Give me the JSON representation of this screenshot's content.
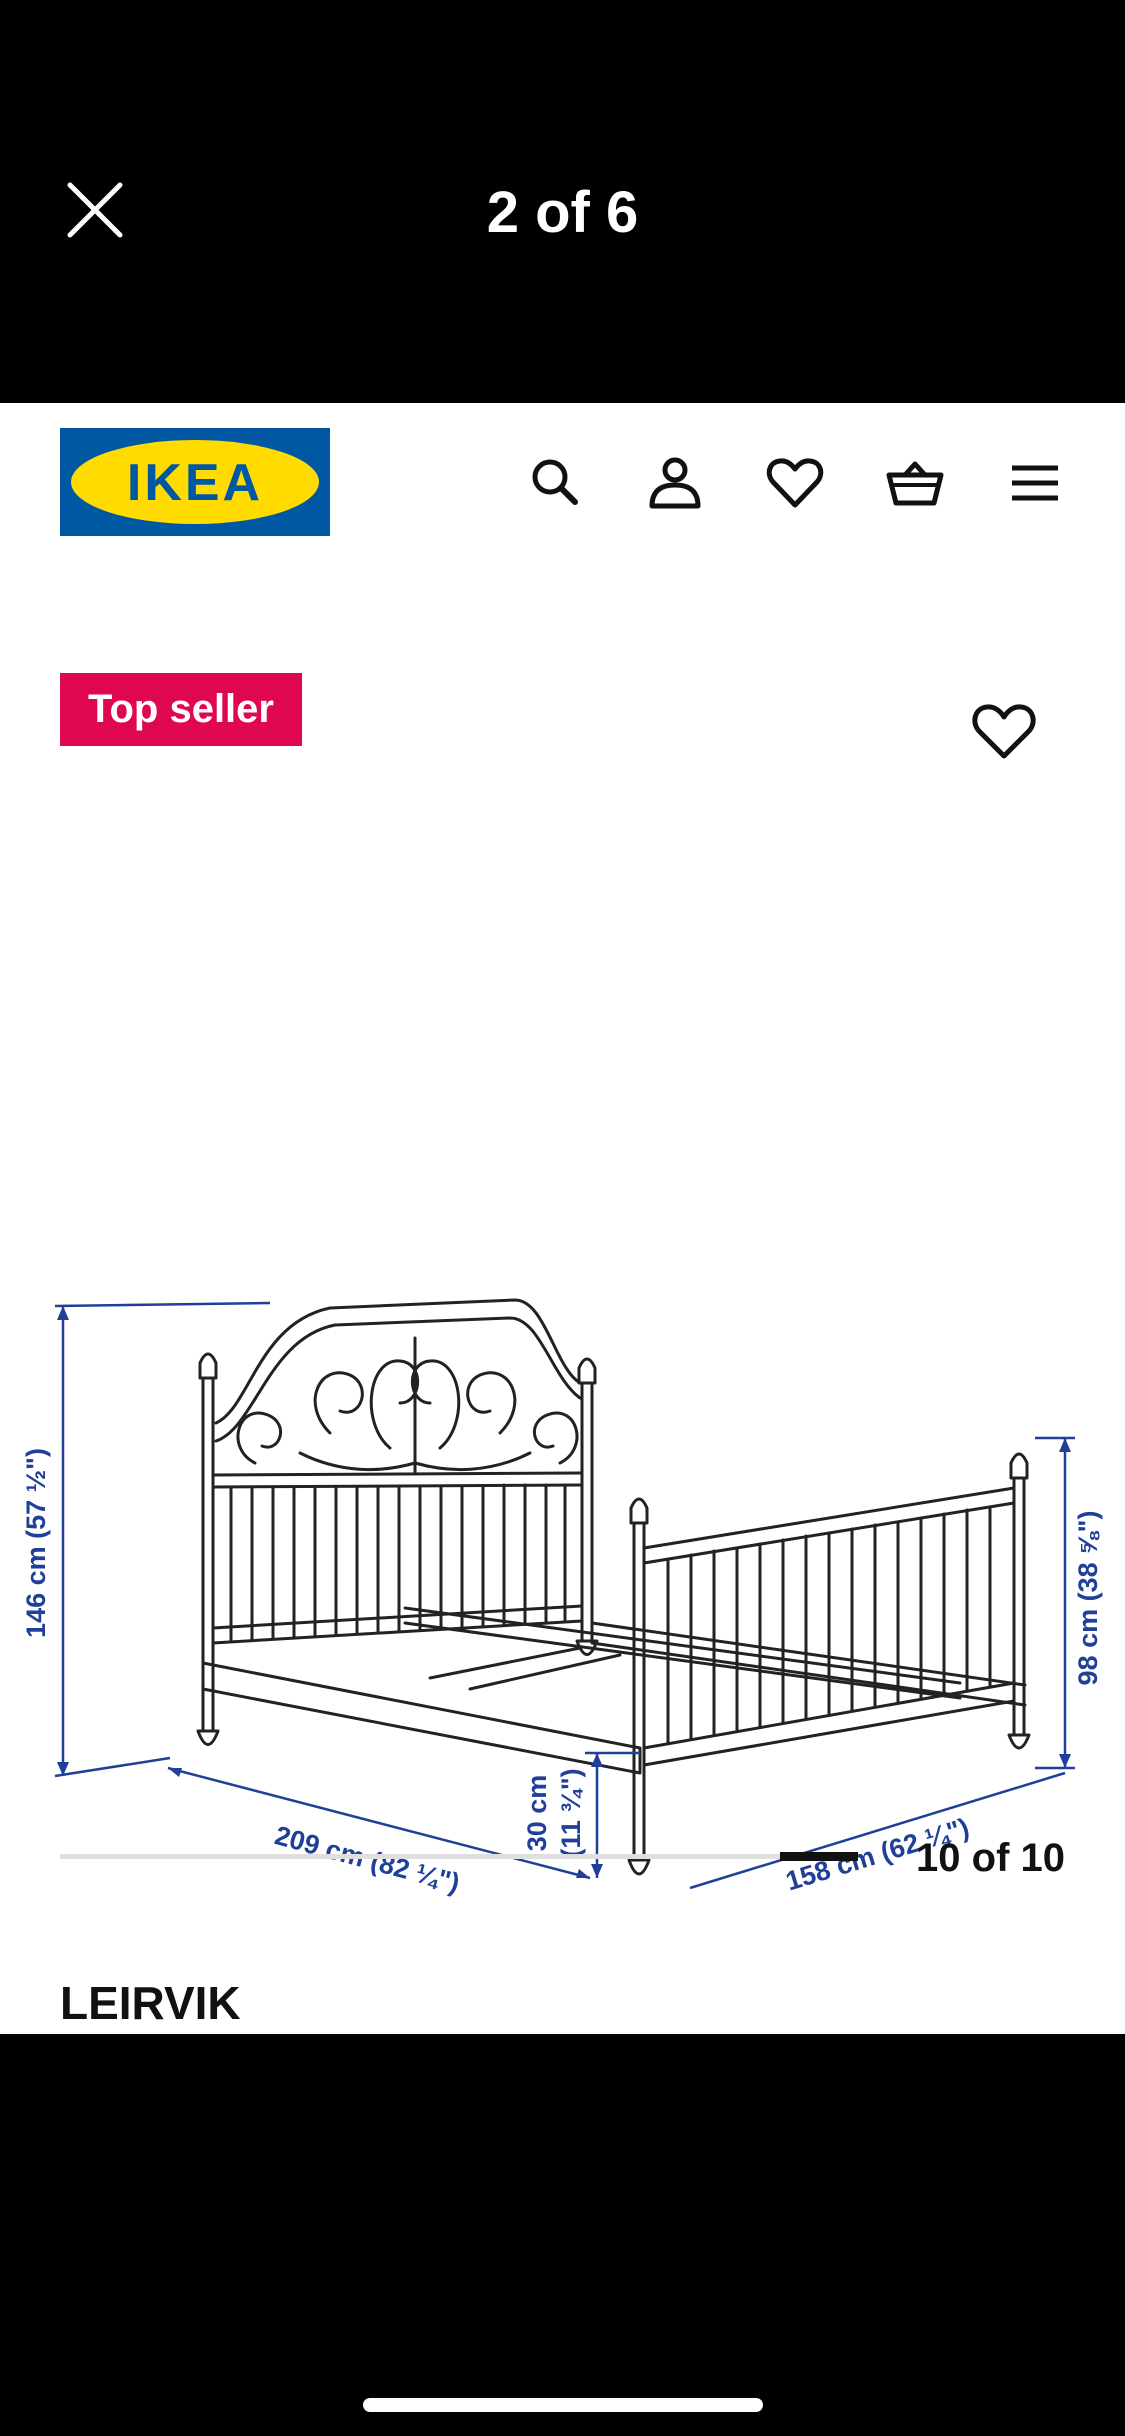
{
  "viewer": {
    "counter": "2 of 6",
    "close_icon": "close-icon"
  },
  "header": {
    "logo_text": "IKEA",
    "icons": [
      "search-icon",
      "user-icon",
      "heart-icon",
      "basket-icon",
      "menu-icon"
    ]
  },
  "product": {
    "badge": "Top seller",
    "name": "LEIRVIK",
    "dimensions": {
      "height": "146 cm (57 ½\")",
      "length": "209 cm (82 ¼\")",
      "under_bed_line1": "30 cm",
      "under_bed_line2": "(11 ¾\")",
      "width": "158 cm (62 ¼\")",
      "footboard": "98 cm (38 ⅝\")"
    }
  },
  "carousel": {
    "counter": "10 of 10",
    "position": 10,
    "total": 10
  },
  "colors": {
    "ikea_blue": "#0058a3",
    "ikea_yellow": "#ffdb00",
    "badge_red": "#e00751",
    "dimension_blue": "#1f3f98"
  }
}
